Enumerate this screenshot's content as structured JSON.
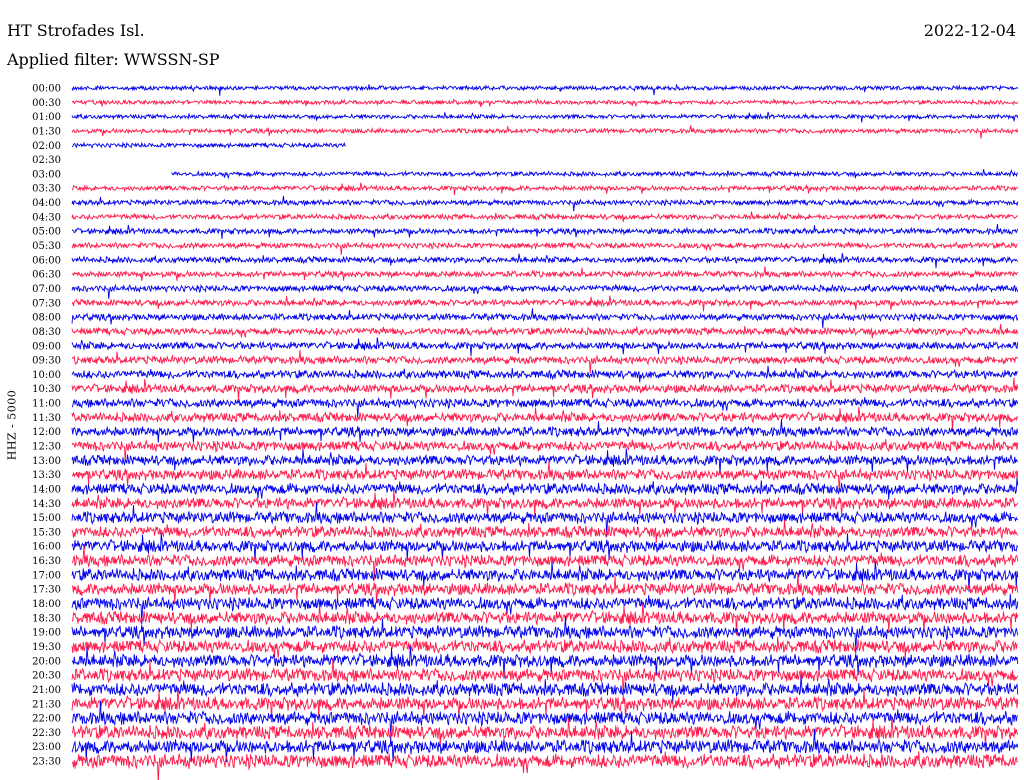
{
  "header": {
    "station": "HT Strofades Isl.",
    "date": "2022-12-04",
    "filter": "Applied filter: WWSSN-SP"
  },
  "colors": {
    "trace_a": "#0000ee",
    "trace_b": "#ff1a4a"
  },
  "chart_data": {
    "type": "line",
    "title": "HT Strofades Isl.",
    "subtitle": "Applied filter: WWSSN-SP",
    "ylabel": "HHZ - 5000",
    "xlabel": "",
    "rows": [
      {
        "label": "00:00",
        "series": "a",
        "start": 0.0,
        "end": 1.0,
        "amp": 0.55
      },
      {
        "label": "00:30",
        "series": "b",
        "start": 0.0,
        "end": 1.0,
        "amp": 0.55
      },
      {
        "label": "01:00",
        "series": "a",
        "start": 0.0,
        "end": 1.0,
        "amp": 0.55
      },
      {
        "label": "01:30",
        "series": "b",
        "start": 0.0,
        "end": 1.0,
        "amp": 0.6
      },
      {
        "label": "02:00",
        "series": "a",
        "start": 0.0,
        "end": 0.29,
        "amp": 0.6
      },
      {
        "label": "02:30",
        "series": "b",
        "start": 0,
        "end": 0,
        "amp": 0
      },
      {
        "label": "03:00",
        "series": "a",
        "start": 0.105,
        "end": 1.0,
        "amp": 0.6
      },
      {
        "label": "03:30",
        "series": "b",
        "start": 0.0,
        "end": 1.0,
        "amp": 0.65
      },
      {
        "label": "04:00",
        "series": "a",
        "start": 0.0,
        "end": 1.0,
        "amp": 0.7
      },
      {
        "label": "04:30",
        "series": "b",
        "start": 0.0,
        "end": 1.0,
        "amp": 0.7
      },
      {
        "label": "05:00",
        "series": "a",
        "start": 0.0,
        "end": 1.0,
        "amp": 0.75
      },
      {
        "label": "05:30",
        "series": "b",
        "start": 0.0,
        "end": 1.0,
        "amp": 0.75
      },
      {
        "label": "06:00",
        "series": "a",
        "start": 0.0,
        "end": 1.0,
        "amp": 0.8
      },
      {
        "label": "06:30",
        "series": "b",
        "start": 0.0,
        "end": 1.0,
        "amp": 0.8
      },
      {
        "label": "07:00",
        "series": "a",
        "start": 0.0,
        "end": 1.0,
        "amp": 0.85
      },
      {
        "label": "07:30",
        "series": "b",
        "start": 0.0,
        "end": 1.0,
        "amp": 0.85
      },
      {
        "label": "08:00",
        "series": "a",
        "start": 0.0,
        "end": 1.0,
        "amp": 0.9
      },
      {
        "label": "08:30",
        "series": "b",
        "start": 0.0,
        "end": 1.0,
        "amp": 0.95
      },
      {
        "label": "09:00",
        "series": "a",
        "start": 0.0,
        "end": 1.0,
        "amp": 1.0
      },
      {
        "label": "09:30",
        "series": "b",
        "start": 0.0,
        "end": 1.0,
        "amp": 1.05
      },
      {
        "label": "10:00",
        "series": "a",
        "start": 0.0,
        "end": 1.0,
        "amp": 1.1
      },
      {
        "label": "10:30",
        "series": "b",
        "start": 0.0,
        "end": 1.0,
        "amp": 1.15
      },
      {
        "label": "11:00",
        "series": "a",
        "start": 0.0,
        "end": 1.0,
        "amp": 1.2
      },
      {
        "label": "11:30",
        "series": "b",
        "start": 0.0,
        "end": 1.0,
        "amp": 1.25
      },
      {
        "label": "12:00",
        "series": "a",
        "start": 0.0,
        "end": 1.0,
        "amp": 1.3
      },
      {
        "label": "12:30",
        "series": "b",
        "start": 0.0,
        "end": 1.0,
        "amp": 1.35
      },
      {
        "label": "13:00",
        "series": "a",
        "start": 0.0,
        "end": 1.0,
        "amp": 1.4
      },
      {
        "label": "13:30",
        "series": "b",
        "start": 0.0,
        "end": 1.0,
        "amp": 1.45
      },
      {
        "label": "14:00",
        "series": "a",
        "start": 0.0,
        "end": 1.0,
        "amp": 1.5
      },
      {
        "label": "14:30",
        "series": "b",
        "start": 0.0,
        "end": 1.0,
        "amp": 1.5
      },
      {
        "label": "15:00",
        "series": "a",
        "start": 0.0,
        "end": 1.0,
        "amp": 1.55
      },
      {
        "label": "15:30",
        "series": "b",
        "start": 0.0,
        "end": 1.0,
        "amp": 1.55
      },
      {
        "label": "16:00",
        "series": "a",
        "start": 0.0,
        "end": 1.0,
        "amp": 1.6
      },
      {
        "label": "16:30",
        "series": "b",
        "start": 0.0,
        "end": 1.0,
        "amp": 1.6
      },
      {
        "label": "17:00",
        "series": "a",
        "start": 0.0,
        "end": 1.0,
        "amp": 1.65
      },
      {
        "label": "17:30",
        "series": "b",
        "start": 0.0,
        "end": 1.0,
        "amp": 1.65
      },
      {
        "label": "18:00",
        "series": "a",
        "start": 0.0,
        "end": 1.0,
        "amp": 1.7
      },
      {
        "label": "18:30",
        "series": "b",
        "start": 0.0,
        "end": 1.0,
        "amp": 1.7
      },
      {
        "label": "19:00",
        "series": "a",
        "start": 0.0,
        "end": 1.0,
        "amp": 1.7
      },
      {
        "label": "19:30",
        "series": "b",
        "start": 0.0,
        "end": 1.0,
        "amp": 1.75
      },
      {
        "label": "20:00",
        "series": "a",
        "start": 0.0,
        "end": 1.0,
        "amp": 1.75
      },
      {
        "label": "20:30",
        "series": "b",
        "start": 0.0,
        "end": 1.0,
        "amp": 1.75
      },
      {
        "label": "21:00",
        "series": "a",
        "start": 0.0,
        "end": 1.0,
        "amp": 1.8
      },
      {
        "label": "21:30",
        "series": "b",
        "start": 0.0,
        "end": 1.0,
        "amp": 1.8
      },
      {
        "label": "22:00",
        "series": "a",
        "start": 0.0,
        "end": 1.0,
        "amp": 1.8
      },
      {
        "label": "22:30",
        "series": "b",
        "start": 0.0,
        "end": 1.0,
        "amp": 1.85
      },
      {
        "label": "23:00",
        "series": "a",
        "start": 0.0,
        "end": 1.0,
        "amp": 1.85
      },
      {
        "label": "23:30",
        "series": "b",
        "start": 0.0,
        "end": 1.0,
        "amp": 1.9
      }
    ]
  }
}
